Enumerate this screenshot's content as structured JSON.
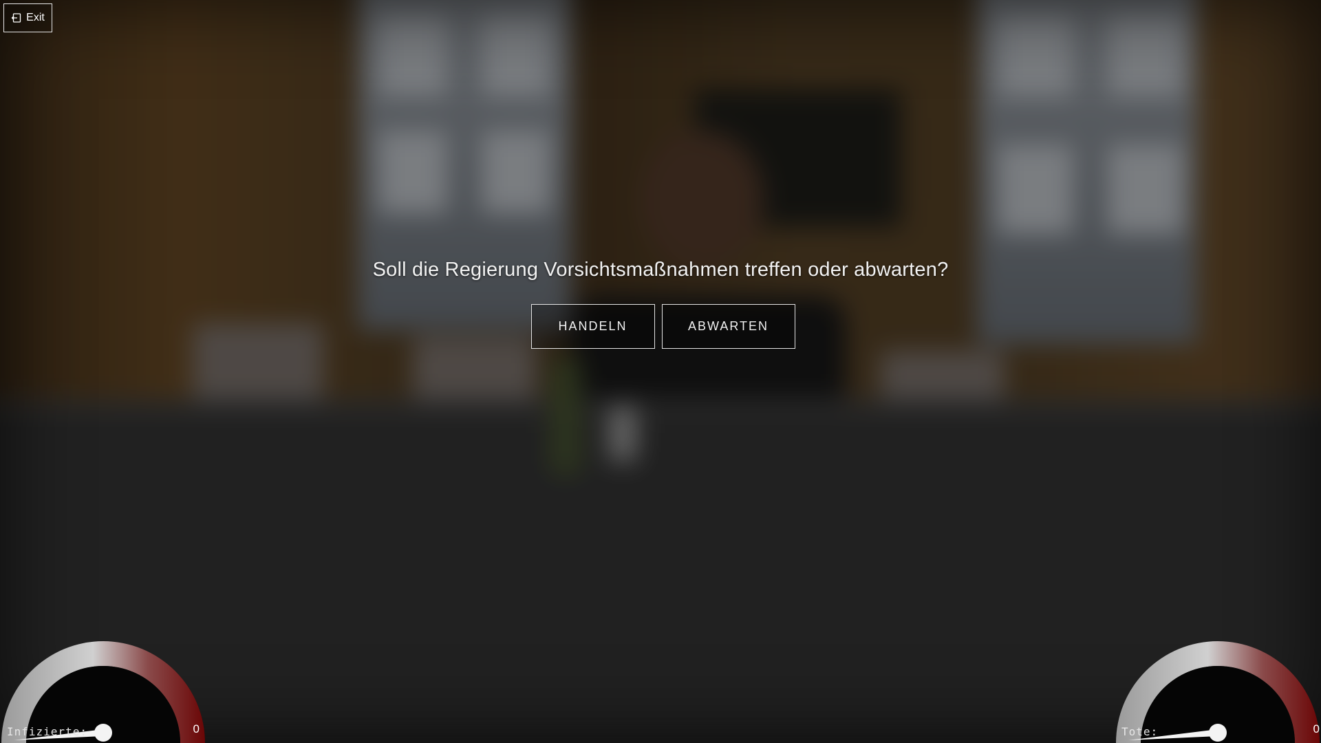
{
  "header": {
    "exit_label": "Exit"
  },
  "dialog": {
    "question": "Soll die Regierung Vorsichtsmaßnahmen treffen oder abwarten?",
    "options": [
      "HANDELN",
      "ABWARTEN"
    ]
  },
  "gauges": {
    "infected": {
      "label": "Infizierte:",
      "value": "0"
    },
    "deaths": {
      "label": "Tote:",
      "value": "0"
    }
  },
  "colors": {
    "gauge_red": "#7a0a0a",
    "gauge_silver": "#b5b5b5",
    "text": "#f2f2f2"
  }
}
